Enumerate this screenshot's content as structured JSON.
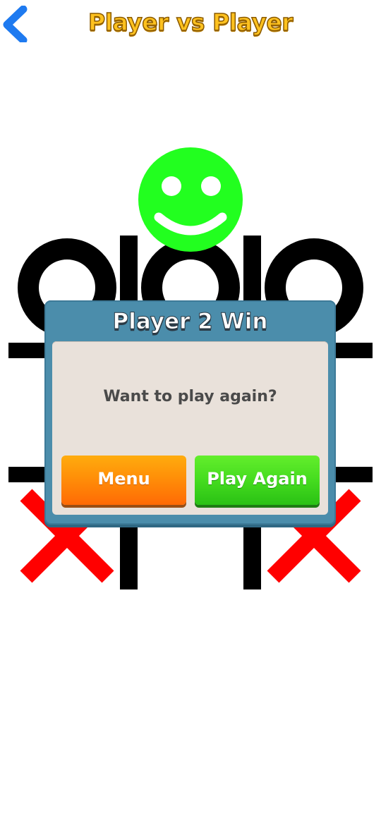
{
  "header": {
    "title": "Player vs Player",
    "back_icon": "chevron-left-icon",
    "title_color": "#ffc21f"
  },
  "board": {
    "cells": [
      "O",
      "O",
      "O",
      "",
      "",
      "",
      "X",
      "",
      "X"
    ],
    "o_color": "#000000",
    "x_color": "#ff0000"
  },
  "status": {
    "icon": "smiley-face-icon",
    "color": "#22ff1f"
  },
  "dialog": {
    "title": "Player 2 Win",
    "message": "Want to play again?",
    "menu_label": "Menu",
    "play_again_label": "Play Again",
    "menu_color": "#ff8f08",
    "play_again_color": "#45dc1f"
  }
}
